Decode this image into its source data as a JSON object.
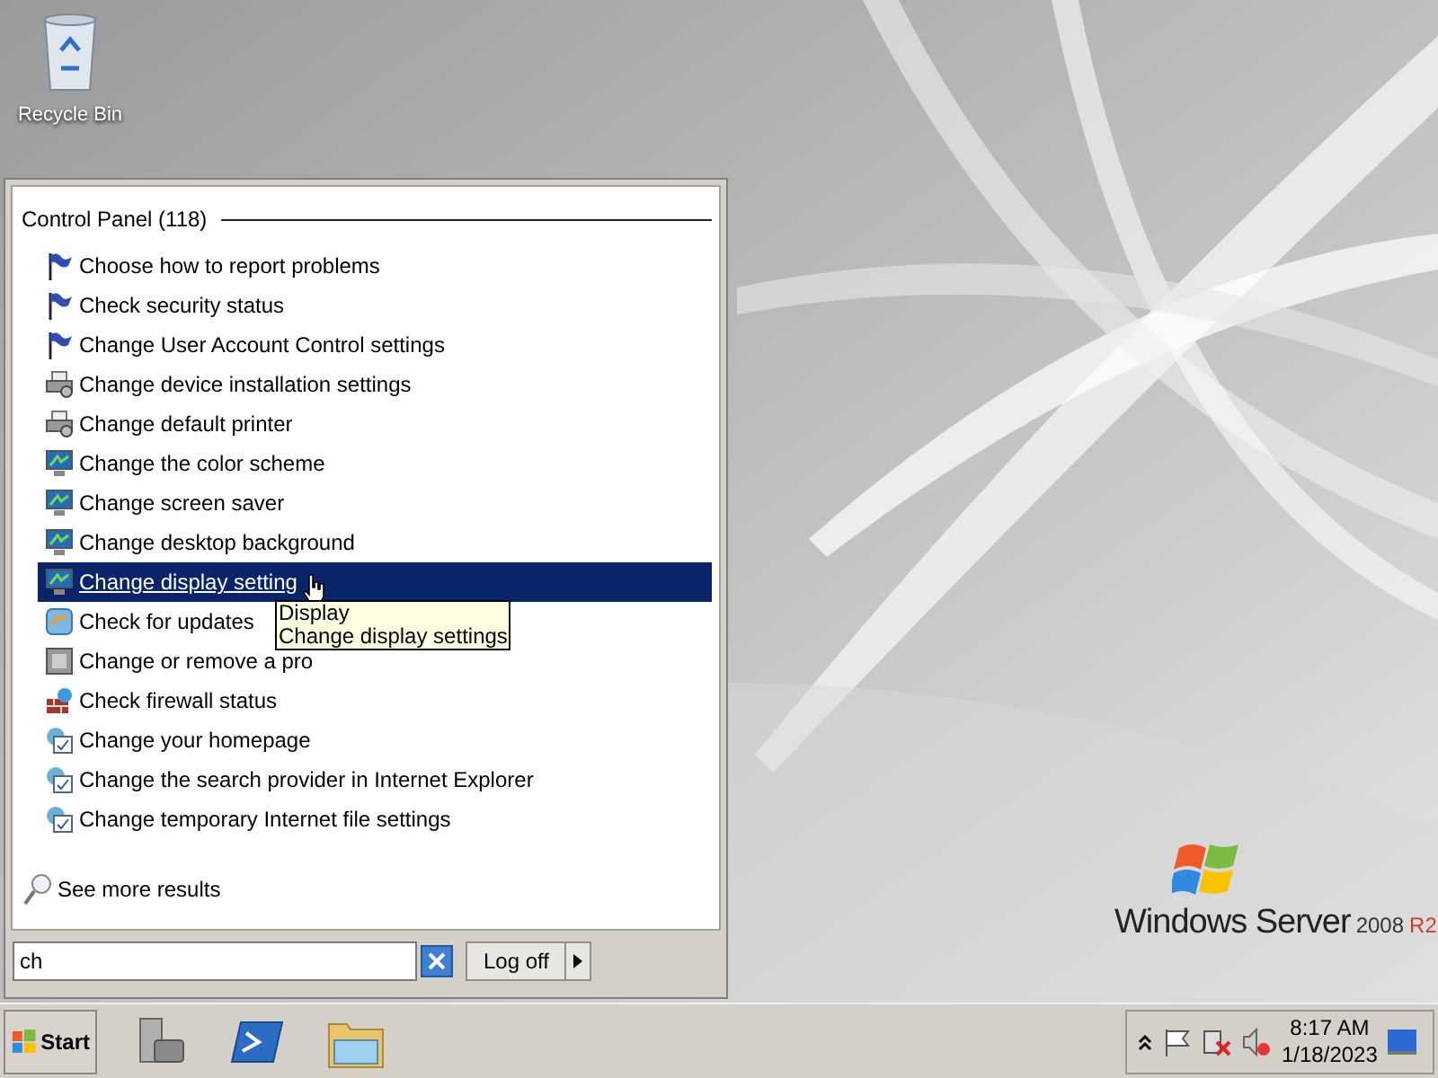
{
  "desktop_icons": [
    {
      "label": "Recycle Bin"
    }
  ],
  "start_menu": {
    "group_heading": "Control Panel (118)",
    "items": [
      {
        "label": "Choose how to report problems",
        "kind": "flag",
        "selected": false
      },
      {
        "label": "Check security status",
        "kind": "flag",
        "selected": false
      },
      {
        "label": "Change User Account Control settings",
        "kind": "flag",
        "selected": false
      },
      {
        "label": "Change device installation settings",
        "kind": "printer",
        "selected": false
      },
      {
        "label": "Change default printer",
        "kind": "printer",
        "selected": false
      },
      {
        "label": "Change the color scheme",
        "kind": "monitor",
        "selected": false
      },
      {
        "label": "Change screen saver",
        "kind": "monitor",
        "selected": false
      },
      {
        "label": "Change desktop background",
        "kind": "monitor",
        "selected": false
      },
      {
        "label": "Change display setting",
        "kind": "monitor",
        "selected": true
      },
      {
        "label": "Check for updates",
        "kind": "update",
        "selected": false
      },
      {
        "label": "Change or remove a pro",
        "kind": "program",
        "selected": false
      },
      {
        "label": "Check firewall status",
        "kind": "firewall",
        "selected": false
      },
      {
        "label": "Change your homepage",
        "kind": "internet",
        "selected": false
      },
      {
        "label": "Change the search provider in Internet Explorer",
        "kind": "internet",
        "selected": false
      },
      {
        "label": "Change temporary Internet file settings",
        "kind": "internet",
        "selected": false
      }
    ],
    "tooltip": [
      "Display",
      "Change display settings"
    ],
    "see_more": "See more results",
    "search": {
      "value": "ch"
    },
    "log_off": "Log off"
  },
  "branding": {
    "name": "Windows Server",
    "version": "2008",
    "edition": "R2"
  },
  "taskbar": {
    "start": "Start",
    "clock": {
      "time": "8:17 AM",
      "date": "1/18/2023"
    }
  }
}
